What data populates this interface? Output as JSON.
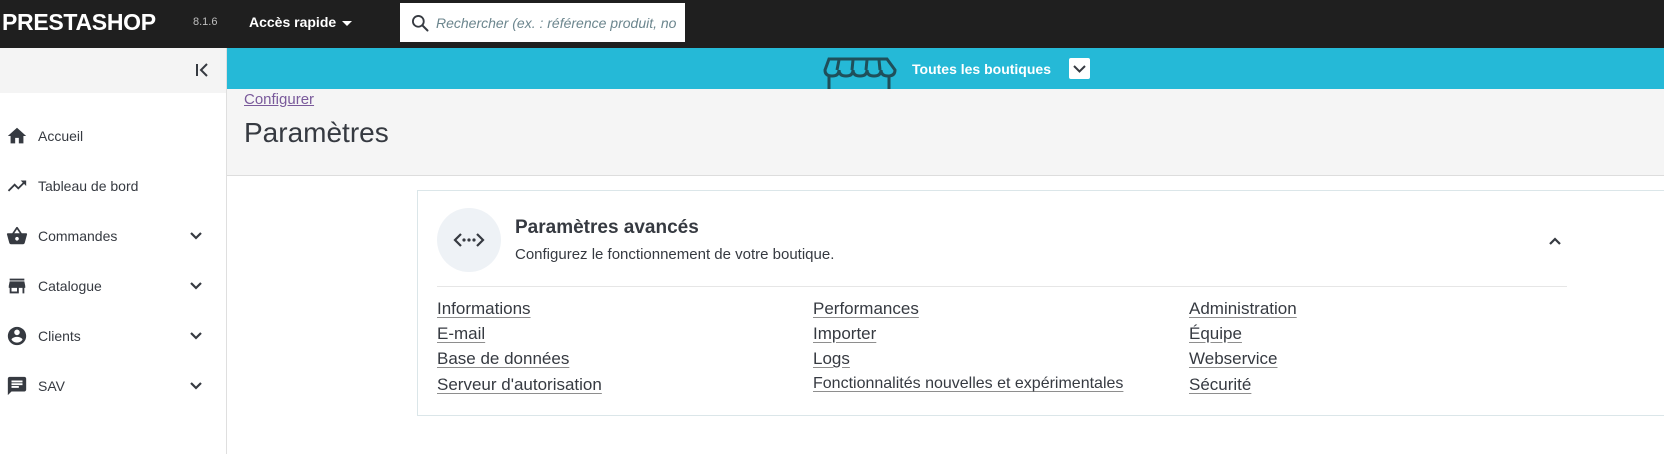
{
  "header": {
    "logo": "PRESTASHOP",
    "version": "8.1.6",
    "quick_access": "Accès rapide",
    "search_placeholder": "Rechercher (ex. : référence produit, no"
  },
  "sidebar": {
    "items": [
      {
        "label": "Accueil",
        "icon": "home-icon"
      },
      {
        "label": "Tableau de bord",
        "icon": "trending-up-icon"
      },
      {
        "label": "Commandes",
        "icon": "shopping-basket-icon"
      },
      {
        "label": "Catalogue",
        "icon": "store-icon"
      },
      {
        "label": "Clients",
        "icon": "account-circle-icon"
      },
      {
        "label": "SAV",
        "icon": "chat-icon"
      }
    ]
  },
  "shopbar": {
    "label": "Toutes les boutiques",
    "color": "#25b9d7"
  },
  "page": {
    "breadcrumb": "Configurer",
    "title": "Paramètres"
  },
  "card": {
    "title": "Paramètres avancés",
    "subtitle": "Configurez le fonctionnement de votre boutique.",
    "links": {
      "col1": [
        "Informations",
        "E-mail",
        "Base de données",
        "Serveur d'autorisation"
      ],
      "col2": [
        "Performances",
        "Importer",
        "Logs",
        "Fonctionnalités nouvelles et expérimentales"
      ],
      "col3": [
        "Administration",
        "Équipe",
        "Webservice",
        "Sécurité"
      ]
    }
  }
}
